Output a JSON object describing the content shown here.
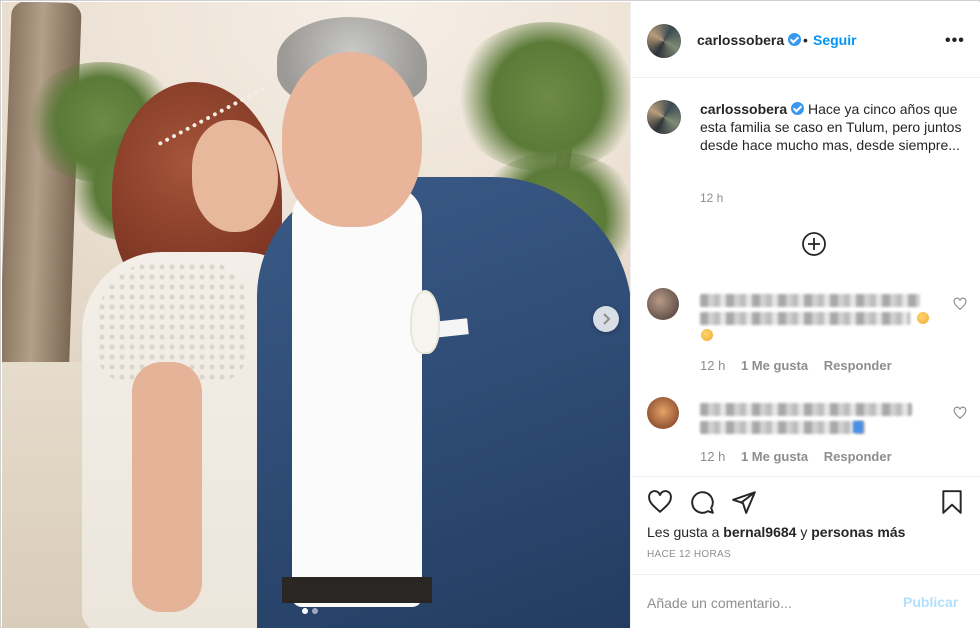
{
  "post": {
    "username": "carlossobera",
    "follow_label": "Seguir",
    "bullet": "•",
    "more_label": "•••",
    "caption_username": "carlossobera",
    "caption_text": " Hace ya cinco años que esta familia se caso en Tulum, pero juntos desde hace mucho mas, desde siempre...",
    "caption_time": "12 h",
    "add_icon": "plus-circle-icon",
    "carousel": {
      "current": 1,
      "total": 2,
      "next_icon": "chevron-right-icon"
    }
  },
  "comments": [
    {
      "time": "12 h",
      "likes": "1 Me gusta",
      "reply": "Responder",
      "text_blurred": true
    },
    {
      "time": "12 h",
      "likes": "1 Me gusta",
      "reply": "Responder",
      "text_blurred": true
    }
  ],
  "actions": {
    "icons": [
      "heart-icon",
      "comment-icon",
      "share-icon",
      "bookmark-icon"
    ],
    "likes_prefix": "Les gusta a ",
    "likes_user": "bernal9684",
    "likes_mid": " y ",
    "likes_suffix": "personas más",
    "ago": "HACE 12 HORAS"
  },
  "comment_bar": {
    "placeholder": "Añade un comentario...",
    "publish_label": "Publicar"
  },
  "colors": {
    "link": "#0095f6",
    "publish_disabled": "#b2dffc",
    "verified": "#3897f0",
    "muted": "#8e8e8e"
  }
}
